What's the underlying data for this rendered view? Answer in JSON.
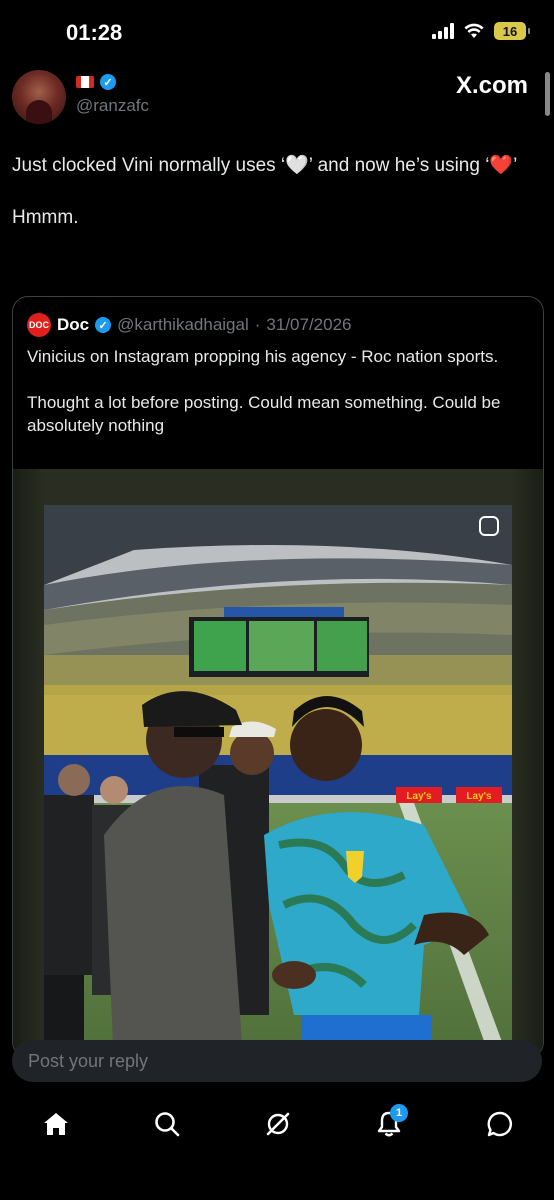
{
  "status_bar": {
    "time": "01:28",
    "battery": "16"
  },
  "tweet": {
    "handle": "@ranzafc",
    "brand": "X.com",
    "text_line1": "Just clocked Vini normally uses ‘🤍’ and now he’s using ‘❤️’",
    "text_line2": "Hmmm."
  },
  "quoted": {
    "logo_text": "DOC",
    "name": "Doc",
    "handle": "@karthikadhaigal",
    "separator": "·",
    "date": "31/07/2026",
    "text1": "Vinicius on Instagram propping his agency - Roc nation sports.",
    "text2": "Thought a lot before posting. Could mean something. Could be absolutely nothing",
    "ads": [
      "Lay's",
      "Lay's"
    ]
  },
  "reply": {
    "placeholder": "Post your reply"
  },
  "nav": {
    "notification_count": "1",
    "icons": [
      "home-icon",
      "search-icon",
      "grok-icon",
      "bell-icon",
      "messages-icon"
    ]
  },
  "colors": {
    "accent": "#1d9bf0",
    "background": "#000000",
    "muted": "#71767b",
    "badge": "#1d9bf0"
  }
}
